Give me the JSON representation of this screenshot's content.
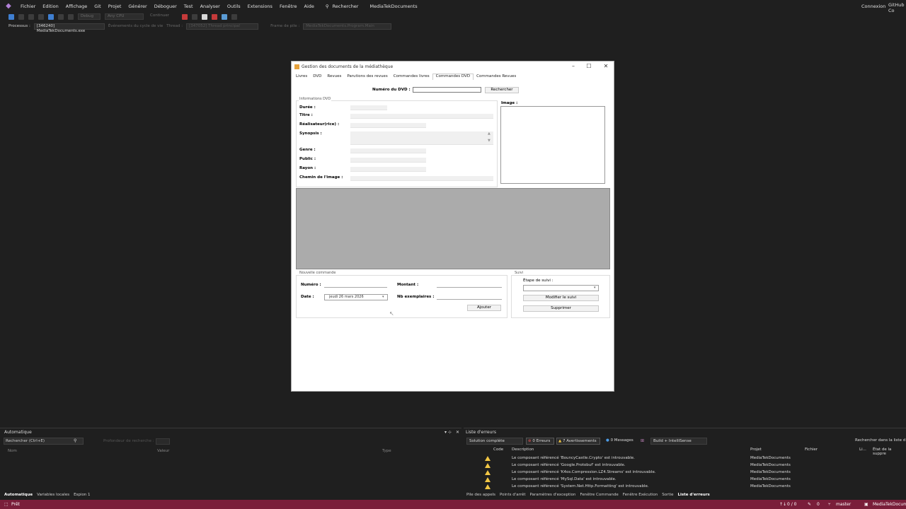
{
  "vs": {
    "menu": [
      "Fichier",
      "Edition",
      "Affichage",
      "Git",
      "Projet",
      "Générer",
      "Déboguer",
      "Test",
      "Analyser",
      "Outils",
      "Extensions",
      "Fenêtre",
      "Aide"
    ],
    "search_label": "Rechercher",
    "solution_name": "MediaTekDocuments",
    "connexion": "Connexion",
    "copilot": "GitHub Co",
    "toolbar": {
      "config": "Debug",
      "platform": "Any CPU",
      "continue": "Continuer"
    },
    "procbar": {
      "process_label": "Processus :",
      "process_value": "[346240] MediaTekDocuments.exe",
      "lifecycle_label": "Événements du cycle de vie",
      "thread_label": "Thread :",
      "thread_value": "[347052] Thread principal",
      "frame_label": "Frame de pile :",
      "frame_value": "MediaTekDocuments.Program.Main"
    }
  },
  "form": {
    "title": "Gestion des documents de la médiathèque",
    "tabs": [
      "Livres",
      "DVD",
      "Revues",
      "Parutions des revues",
      "Commandes livres",
      "Commandes DVD",
      "Commandes Revues"
    ],
    "active_tab": "Commandes DVD",
    "search": {
      "label": "Numéro du DVD :",
      "button": "Rechercher"
    },
    "info_group": "Informations DVD",
    "info_labels": {
      "duree": "Durée :",
      "titre": "Titre :",
      "realisateur": "Réalisateur(rice) :",
      "synopsis": "Synopsis :",
      "genre": "Genre :",
      "public": "Public :",
      "rayon": "Rayon :",
      "chemin": "Chemin de l'image :"
    },
    "image_label": "Image :",
    "new_order_group": "Nouvelle commande",
    "new_order": {
      "numero": "Numéro :",
      "montant": "Montant :",
      "date": "Date :",
      "date_value": "jeudi   26   mars   2026",
      "nb_exemplaires": "Nb exemplaires :",
      "add_button": "Ajouter"
    },
    "suivi_group": "Suivi",
    "suivi": {
      "etape_label": "Étape de suivi :",
      "modify_button": "Modifier le suivi",
      "delete_button": "Supprimer"
    }
  },
  "auto_panel": {
    "title": "Automatique",
    "search_placeholder": "Rechercher (Ctrl+E)",
    "depth_label": "Profondeur de recherche :",
    "cols": [
      "Nom",
      "Valeur",
      "Type"
    ],
    "tabs": [
      "Automatique",
      "Variables locales",
      "Espion 1"
    ]
  },
  "errors_panel": {
    "title": "Liste d'erreurs",
    "scope": "Solution complète",
    "errors": "0 Erreurs",
    "warnings": "7 Avertissements",
    "messages": "0 Messages",
    "build_filter": "Build + IntelliSense",
    "search": "Rechercher dans la liste d",
    "cols": [
      "Code",
      "Description",
      "Projet",
      "Fichier",
      "Li...",
      "État de la suppre"
    ],
    "rows": [
      {
        "desc": "Le composant référencé 'BouncyCastle.Crypto' est introuvable.",
        "project": "MediaTekDocuments"
      },
      {
        "desc": "Le composant référencé 'Google.Protobuf' est introuvable.",
        "project": "MediaTekDocuments"
      },
      {
        "desc": "Le composant référencé 'K4os.Compression.LZ4.Streams' est introuvable.",
        "project": "MediaTekDocuments"
      },
      {
        "desc": "Le composant référencé 'MySql.Data' est introuvable.",
        "project": "MediaTekDocuments"
      },
      {
        "desc": "Le composant référencé 'System.Net.Http.Formatting' est introuvable.",
        "project": "MediaTekDocuments"
      }
    ],
    "tabs": [
      "Pile des appels",
      "Points d'arrêt",
      "Paramètres d'exception",
      "Fenêtre Commande",
      "Fenêtre Exécution",
      "Sortie",
      "Liste d'erreurs"
    ]
  },
  "status": {
    "left": "Prêt",
    "counter": "0 / 0",
    "changes": "0",
    "branch": "master",
    "repo": "MediaTekDocuments"
  }
}
